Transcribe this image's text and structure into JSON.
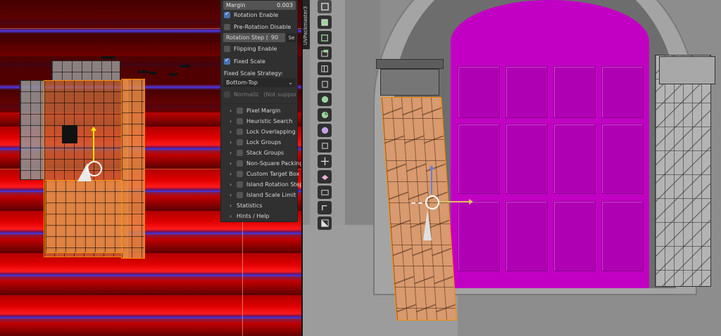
{
  "panel": {
    "margin": {
      "label": "Margin",
      "value": "0.003"
    },
    "rotation_enable": {
      "label": "Rotation Enable",
      "checked": true
    },
    "pre_rotation_disable": {
      "label": "Pre-Rotation Disable",
      "checked": false
    },
    "rotation_step": {
      "label": "Rotation Step (",
      "value": "90",
      "unit": "Se"
    },
    "flipping_enable": {
      "label": "Flipping Enable",
      "checked": false
    },
    "fixed_scale": {
      "label": "Fixed Scale",
      "checked": true
    },
    "fixed_scale_strategy": {
      "label": "Fixed Scale Strategy:",
      "value": "Bottom-Top"
    },
    "normalize": {
      "label": "Normaliz...",
      "note": "(Not suppor..."
    },
    "sections": [
      {
        "label": "Pixel Margin"
      },
      {
        "label": "Heuristic Search"
      },
      {
        "label": "Lock Overlapping"
      },
      {
        "label": "Lock Groups"
      },
      {
        "label": "Stack Groups"
      },
      {
        "label": "Non-Square Packing"
      },
      {
        "label": "Custom Target Box"
      },
      {
        "label": "Island Rotation Step"
      },
      {
        "label": "Island Scale Limit"
      }
    ],
    "statistics": "Statistics",
    "hints": "Hints / Help"
  },
  "viewport": {
    "sidebar_tab": "UVPackmaster3",
    "tools": [
      {
        "icon": "select-box-icon",
        "active": true
      },
      {
        "icon": "cursor-icon"
      },
      {
        "icon": "move-icon"
      },
      {
        "icon": "rotate-icon"
      },
      {
        "icon": "scale-icon"
      },
      {
        "icon": "transform-icon"
      },
      {
        "icon": "annotate-icon"
      },
      {
        "icon": "measure-icon"
      },
      {
        "icon": "add-cube-icon"
      },
      {
        "icon": "extrude-icon"
      },
      {
        "icon": "inset-icon"
      },
      {
        "icon": "bevel-icon"
      },
      {
        "icon": "loop-cut-icon"
      },
      {
        "icon": "knife-icon"
      },
      {
        "icon": "poly-build-icon"
      },
      {
        "icon": "spin-icon"
      },
      {
        "icon": "smooth-icon"
      },
      {
        "icon": "shrink-fatten-icon"
      }
    ],
    "colors": {
      "door": "#c200c4",
      "selection": "#ff8a00",
      "uv_background": "#e00000"
    }
  }
}
